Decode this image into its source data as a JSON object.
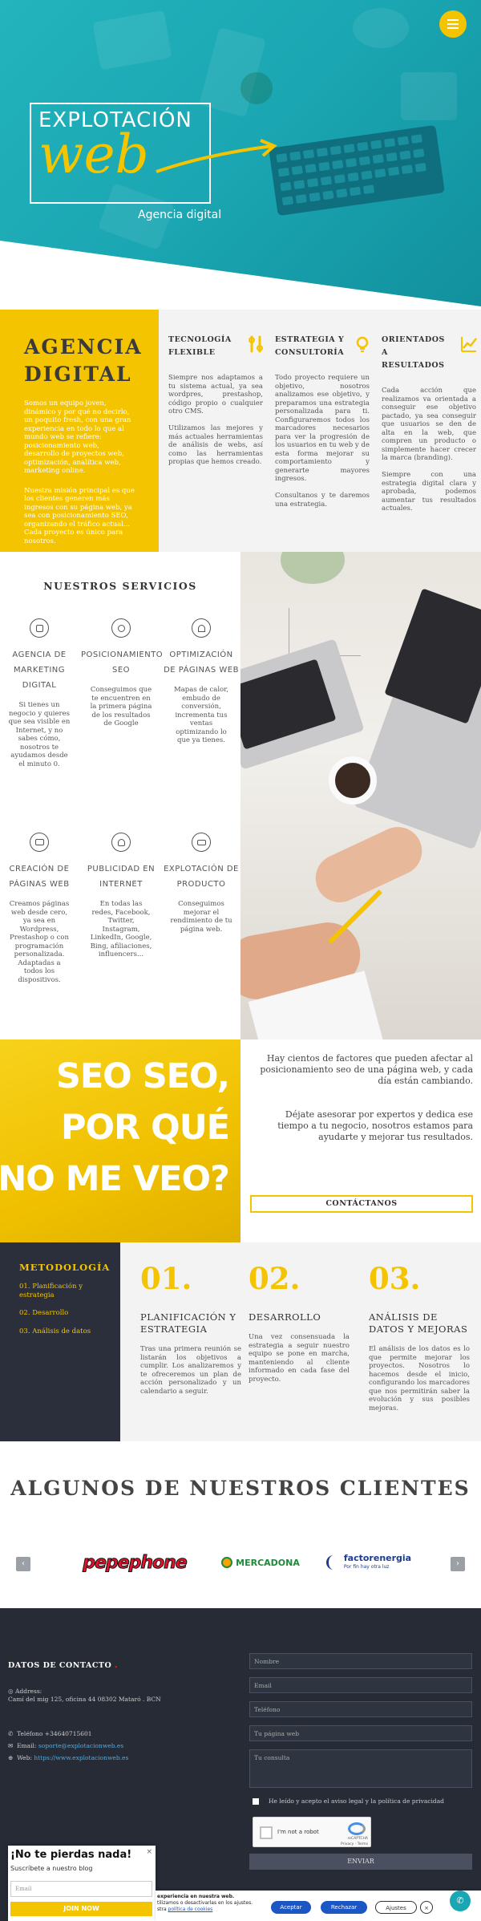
{
  "hero": {
    "logo_title": "EXPLOTACIÓN",
    "logo_web": "web",
    "logo_sub": "Agencia digital"
  },
  "agencia": {
    "title": "AGENCIA DIGITAL",
    "p1": "Somos un equipo joven, dinámico y por qué no decirlo, un poquito fresh, con una gran experiencia en todo lo que al mundo web se refiere: posicionamiento web, desarrollo de proyectos web, optimización, analítica web, marketing online.",
    "p2": "Nuestra misión principal es que los clientes generen más ingresos con su página web, ya sea con posicionamiento SEO, organizando el tráfico actual... Cada proyecto es único para nosotros."
  },
  "features": [
    {
      "title": "TECNOLOGÍA FLEXIBLE",
      "icon": "tools-icon",
      "text": "Siempre nos adaptamos a tu sistema actual, ya sea wordpres, prestashop, código propio o cualquier otro CMS.\n\nUtilizamos las mejores y más actuales herramientas de análisis de webs, así como las herramientas propias que hemos creado."
    },
    {
      "title": "ESTRATEGIA Y CONSULTORÍA",
      "icon": "lightbulb-icon",
      "text": "Todo proyecto requiere un objetivo, nosotros analizamos ese objetivo, y preparamos una estrategia personalizada para ti. Configuraremos todos los marcadores necesarios para ver la progresión de los usuarios en tu web y de esta forma mejorar su comportamiento y generarte mayores ingresos.\n\nConsultanos y te daremos una estrategia."
    },
    {
      "title": "ORIENTADOS A RESULTADOS",
      "icon": "chart-icon",
      "text": "Cada acción que realizamos va orientada a conseguir ese objetivo pactado, ya sea conseguir que usuarios se den de alta en la web, que compren un producto o simplemente hacer crecer la marca (branding).\n\nSiempre con una estrategia digital clara y aprobada, podemos aumentar tus resultados actuales."
    }
  ],
  "servicios": {
    "title": "NUESTROS SERVICIOS",
    "items": [
      {
        "title": "AGENCIA DE MARKETING DIGITAL",
        "icon": "chat-icon",
        "text": "Si tienes un negocio y quieres que sea visible en Internet, y no sabes cómo, nosotros te ayudamos desde el minuto 0."
      },
      {
        "title": "POSICIONAMIENTO SEO",
        "icon": "target-icon",
        "text": "Conseguimos que te encuentren en la primera página de los resultados de Google"
      },
      {
        "title": "OPTIMIZACIÓN DE PÁGINAS WEB",
        "icon": "speed-icon",
        "text": "Mapas de calor, embudo de conversión, incrementa tus ventas optimizando lo que ya tienes."
      },
      {
        "title": "CREACIÓN DE PÁGINAS WEB",
        "icon": "browser-icon",
        "text": "Creamos páginas web desde cero, ya sea en Wordpress, Prestashop o con programación personalizada. Adaptadas a todos los dispositivos."
      },
      {
        "title": "PUBLICIDAD EN INTERNET",
        "icon": "headphones-icon",
        "text": "En todas las redes, Facebook, Twitter, Instagram, LinkedIn, Google, Bing, afiliaciones, influencers..."
      },
      {
        "title": "EXPLOTACIÓN DE PRODUCTO",
        "icon": "card-icon",
        "text": "Conseguimos mejorar el rendimiento de tu página web."
      }
    ]
  },
  "seo": {
    "line1": "SEO SEO,",
    "line2": "POR QUÉ",
    "line3": "NO ME VEO?",
    "p1": "Hay cientos de factores que pueden afectar al posicionamiento seo de una página web, y cada día están cambiando.",
    "p2": "Déjate asesorar por expertos y dedica ese tiempo a tu negocio, nosotros estamos para ayudarte y mejorar tus resultados.",
    "button": "CONTÁCTANOS"
  },
  "metodologia": {
    "title": "METODOLOGÍA",
    "items": [
      "01. Planificación y estrategia",
      "02. Desarrollo",
      "03. Análisis de datos"
    ],
    "steps": [
      {
        "num": "01.",
        "title": "PLANIFICACIÓN Y ESTRATEGIA",
        "text": "Tras una primera reunión se listarán los objetivos a cumplir. Los analizaremos y te ofreceremos un plan de acción personalizado y un calendario a seguir."
      },
      {
        "num": "02.",
        "title": "DESARROLLO",
        "text": "Una vez consensuada la estrategia a seguir nuestro equipo se pone en marcha, manteniendo al cliente informado en cada fase del proyecto."
      },
      {
        "num": "03.",
        "title": "ANÁLISIS DE DATOS Y MEJORAS",
        "text": "El análisis de los datos es lo que permite mejorar los proyectos. Nosotros lo hacemos desde el inicio, configurando los marcadores que nos permitirán saber la evolución y sus posibles mejoras."
      }
    ]
  },
  "clientes": {
    "title": "ALGUNOS DE NUESTROS CLIENTES",
    "prev": "‹",
    "next": "›",
    "logos": [
      {
        "name": "pepephone",
        "color": "#e4122c"
      },
      {
        "name": "MERCADONA",
        "color": "#1f8a3b"
      },
      {
        "name": "factorenergia",
        "sub": "Por fin hay otra luz",
        "color": "#1e3c8f"
      }
    ]
  },
  "footer": {
    "title": "DATOS DE CONTACTO",
    "address_label": "Address:",
    "address": "Camí del mig 125, oficina 44 08302 Mataró . BCN",
    "phone": "Teléfono +34640715601",
    "email_label": "Email:",
    "email": "soporte@explotacionweb.es",
    "web_label": "Web:",
    "web": "https://www.explotacionweb.es",
    "form": {
      "nombre": "Nombre",
      "email": "Email",
      "telefono": "Teléfono",
      "pagina": "Tu página web",
      "consulta": "Tu consulta",
      "legal": "He leído y acepto el aviso legal y la política de privacidad",
      "send": "ENVIAR"
    },
    "recaptcha": {
      "label": "I'm not a robot",
      "brand": "reCAPTCHA",
      "legal": "Privacy - Terms"
    }
  },
  "popup": {
    "title": "¡No te pierdas nada!",
    "sub": "Suscríbete a nuestro blog",
    "placeholder": "Email",
    "button": "JOIN NOW",
    "close": "×"
  },
  "cookie": {
    "text1": "experiencia en nuestra web.",
    "text2": "tilizamos o desactivarlas en los ajustes.",
    "text3": "stra",
    "link": "política de cookies",
    "accept": "Aceptar",
    "reject": "Rechazar",
    "settings": "Ajustes",
    "close": "×"
  },
  "colors": {
    "yellow": "#f5c400",
    "teal": "#1aa6b2",
    "dark": "#262b36"
  }
}
